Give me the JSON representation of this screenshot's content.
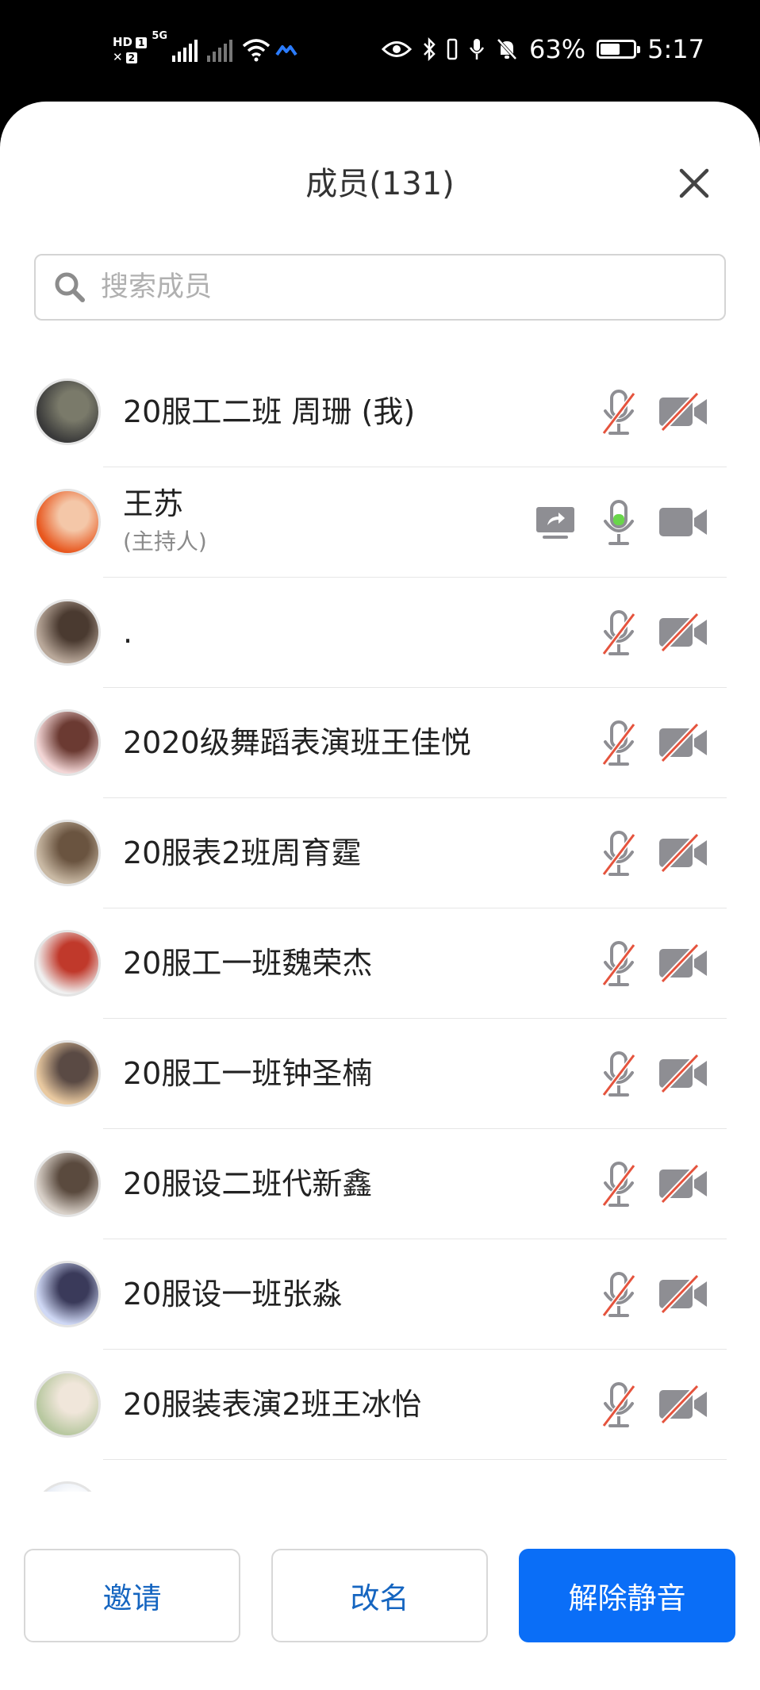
{
  "status_bar": {
    "network_labels": [
      "HD",
      "1",
      "2",
      "5G"
    ],
    "battery_text": "63%",
    "battery_level": 0.63,
    "time": "5:17",
    "icons": [
      "eye-icon",
      "bluetooth-icon",
      "vibrate-icon",
      "mic-icon",
      "bell-off-icon",
      "battery-icon"
    ]
  },
  "header": {
    "title": "成员(131)"
  },
  "search": {
    "placeholder": "搜索成员"
  },
  "colors": {
    "primary": "#0a6ef7",
    "link": "#1565c0",
    "mic_active": "#69d64a",
    "muted_strike": "#e5533d",
    "icon_gray": "#8e8e93"
  },
  "members": [
    {
      "name": "20服工二班 周珊 (我)",
      "role": "",
      "mic_on": false,
      "cam_on": false,
      "sharing": false,
      "avatar_colors": [
        "#3a3a3a",
        "#7a7a6a"
      ]
    },
    {
      "name": "王苏",
      "role": "(主持人)",
      "mic_on": true,
      "cam_on": true,
      "sharing": true,
      "avatar_colors": [
        "#e8571e",
        "#f4c7a8"
      ]
    },
    {
      "name": ".",
      "role": "",
      "mic_on": false,
      "cam_on": false,
      "sharing": false,
      "avatar_colors": [
        "#b9a89a",
        "#4a3a30"
      ]
    },
    {
      "name": "2020级舞蹈表演班王佳悦",
      "role": "",
      "mic_on": false,
      "cam_on": false,
      "sharing": false,
      "avatar_colors": [
        "#f3d6d6",
        "#6b3a32"
      ]
    },
    {
      "name": "20服表2班周育霆",
      "role": "",
      "mic_on": false,
      "cam_on": false,
      "sharing": false,
      "avatar_colors": [
        "#c9b9a4",
        "#6a5440"
      ]
    },
    {
      "name": "20服工一班魏荣杰",
      "role": "",
      "mic_on": false,
      "cam_on": false,
      "sharing": false,
      "avatar_colors": [
        "#f0f0f0",
        "#c0392b"
      ]
    },
    {
      "name": "20服工一班钟圣楠",
      "role": "",
      "mic_on": false,
      "cam_on": false,
      "sharing": false,
      "avatar_colors": [
        "#e9c9a0",
        "#5a4a44"
      ]
    },
    {
      "name": "20服设二班代新鑫",
      "role": "",
      "mic_on": false,
      "cam_on": false,
      "sharing": false,
      "avatar_colors": [
        "#d8d0c8",
        "#5a4a3e"
      ]
    },
    {
      "name": "20服设一班张淼",
      "role": "",
      "mic_on": false,
      "cam_on": false,
      "sharing": false,
      "avatar_colors": [
        "#cfd8f5",
        "#3a3a5a"
      ]
    },
    {
      "name": "20服装表演2班王冰怡",
      "role": "",
      "mic_on": false,
      "cam_on": false,
      "sharing": false,
      "avatar_colors": [
        "#b8c8a0",
        "#f0e6da"
      ]
    },
    {
      "name": "",
      "role": "",
      "mic_on": false,
      "cam_on": false,
      "sharing": false,
      "avatar_colors": [
        "#dfe6f2",
        "#ffffff"
      ]
    }
  ],
  "actions": {
    "invite": "邀请",
    "rename": "改名",
    "unmute_all": "解除静音"
  }
}
